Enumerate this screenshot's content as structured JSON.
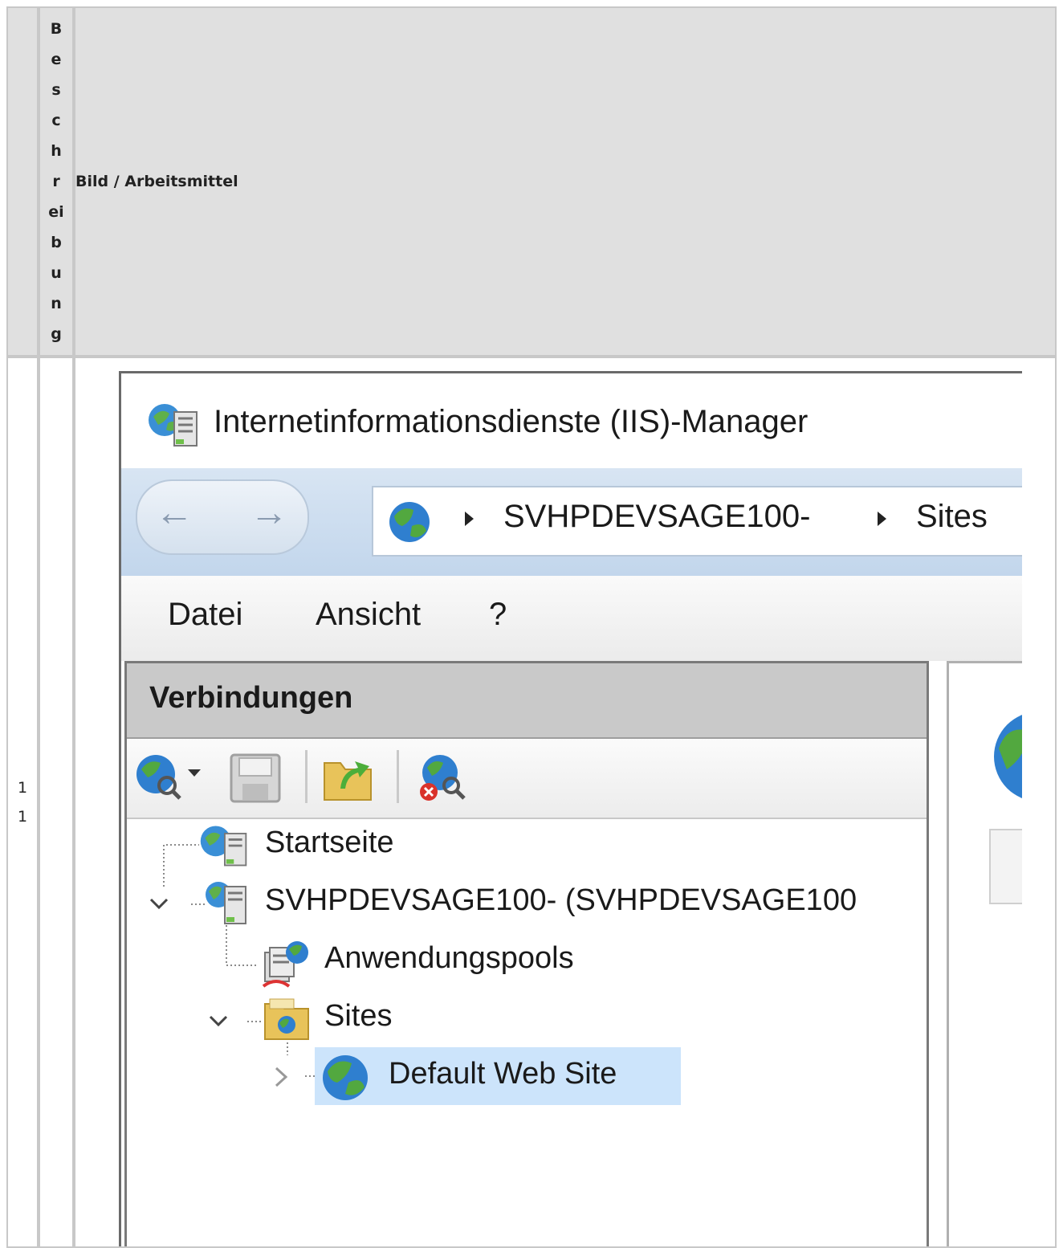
{
  "table": {
    "header_col1": "Beschreibung",
    "header_col1_letters": [
      "B",
      "e",
      "s",
      "c",
      "h",
      "r",
      "ei",
      "b",
      "u",
      "n",
      "g"
    ],
    "header_col2": "Bild / Arbeitsmittel",
    "row_number_lines": [
      "1",
      "1"
    ]
  },
  "iis": {
    "window_title": "Internetinformationsdienste (IIS)-Manager",
    "breadcrumb": [
      "SVHPDEVSAGE100-",
      "Sites"
    ],
    "menu": [
      "Datei",
      "Ansicht",
      "?"
    ],
    "connections_title": "Verbindungen",
    "tree": {
      "start": "Startseite",
      "server": "SVHPDEVSAGE100- (SVHPDEVSAGE100",
      "app_pools": "Anwendungspools",
      "sites": "Sites",
      "default_site": "Default Web Site"
    },
    "colors": {
      "nav_bg": "#c2d6ec",
      "selection": "#cce4fb",
      "panel_header": "#c9c9c9"
    }
  }
}
